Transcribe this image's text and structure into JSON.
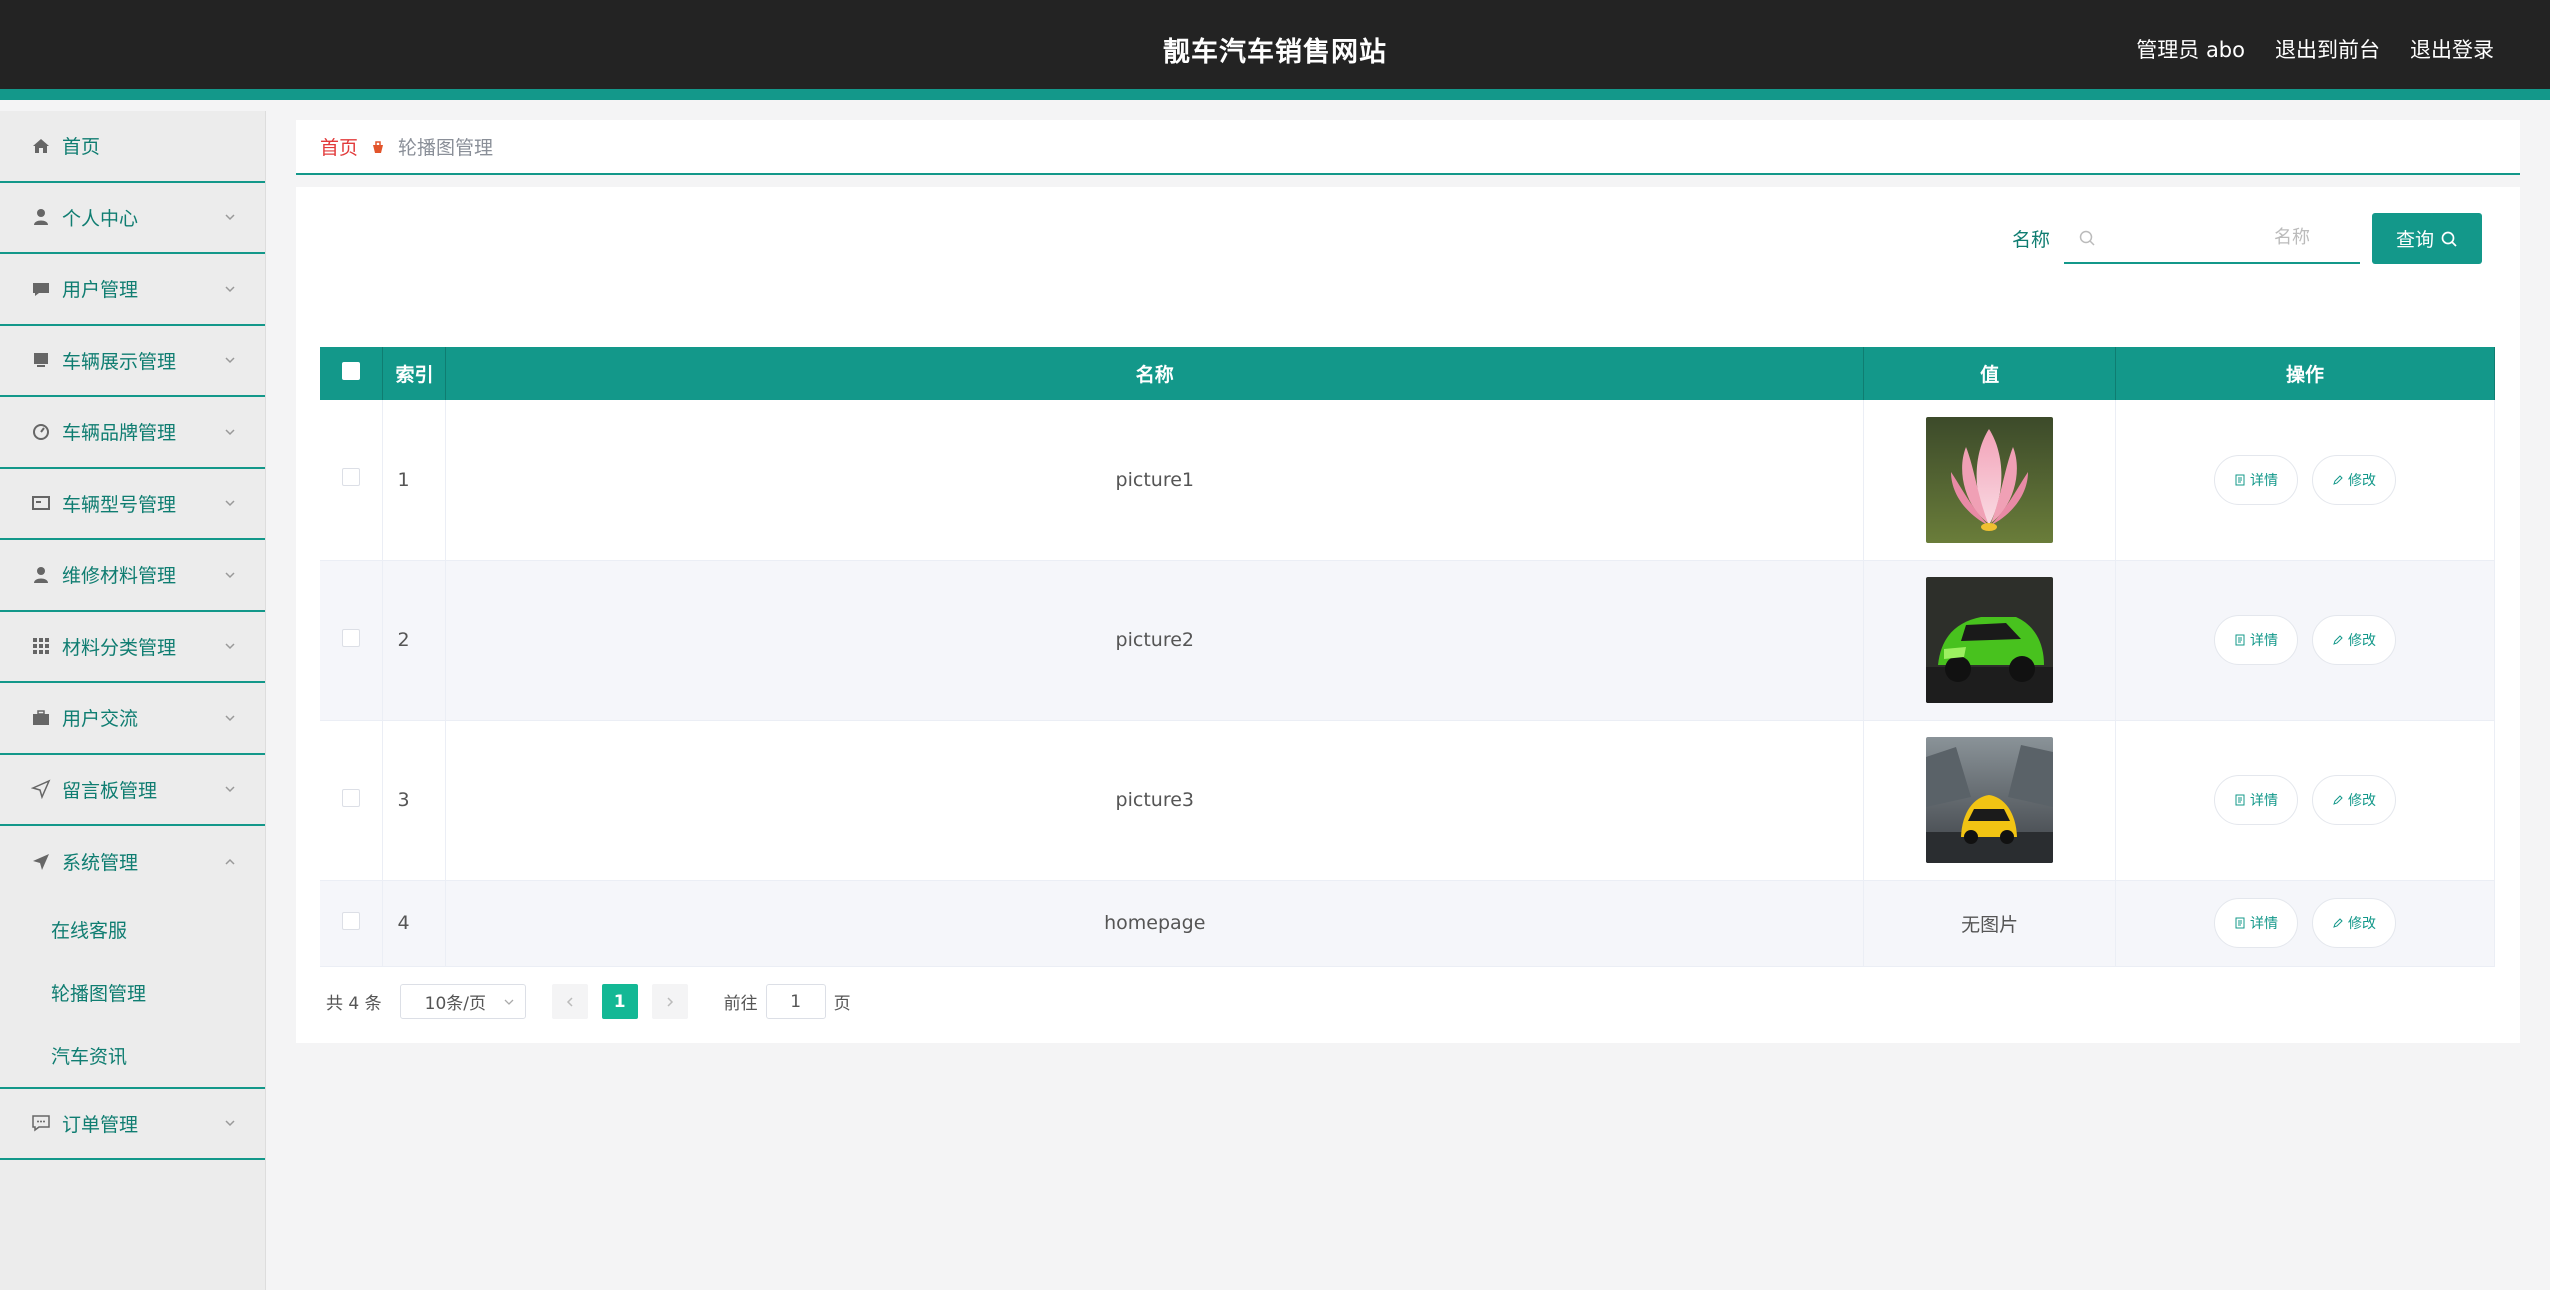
{
  "header": {
    "title": "靓车汽车销售网站",
    "user": "管理员 abo",
    "to_front": "退出到前台",
    "logout": "退出登录"
  },
  "sidebar": {
    "items": [
      {
        "label": "首页",
        "icon": "home-icon"
      },
      {
        "label": "个人中心",
        "icon": "user-icon"
      },
      {
        "label": "用户管理",
        "icon": "chat-icon"
      },
      {
        "label": "车辆展示管理",
        "icon": "monitor-icon"
      },
      {
        "label": "车辆品牌管理",
        "icon": "compass-icon"
      },
      {
        "label": "车辆型号管理",
        "icon": "card-icon"
      },
      {
        "label": "维修材料管理",
        "icon": "user-icon"
      },
      {
        "label": "材料分类管理",
        "icon": "grid-icon"
      },
      {
        "label": "用户交流",
        "icon": "briefcase-icon"
      },
      {
        "label": "留言板管理",
        "icon": "send-icon"
      },
      {
        "label": "系统管理",
        "icon": "paper-plane-icon"
      }
    ],
    "system_sub": [
      "在线客服",
      "轮播图管理",
      "汽车资讯"
    ],
    "order": {
      "label": "订单管理",
      "icon": "message-icon"
    }
  },
  "breadcrumb": {
    "home": "首页",
    "current": "轮播图管理"
  },
  "search": {
    "label": "名称",
    "placeholder": "名称",
    "button": "查询"
  },
  "table": {
    "headers": {
      "index": "索引",
      "name": "名称",
      "value": "值",
      "ops": "操作"
    },
    "rows": [
      {
        "index": "1",
        "name": "picture1",
        "image": "lotus"
      },
      {
        "index": "2",
        "name": "picture2",
        "image": "green-car"
      },
      {
        "index": "3",
        "name": "picture3",
        "image": "yellow-car"
      },
      {
        "index": "4",
        "name": "homepage",
        "value_text": "无图片"
      }
    ],
    "detail_label": "详情",
    "edit_label": "修改"
  },
  "pagination": {
    "total": "共 4 条",
    "page_size": "10条/页",
    "current": "1",
    "goto_label": "前往",
    "goto_value": "1",
    "page_suffix": "页"
  },
  "colors": {
    "accent": "#13988a",
    "header_bg": "#232323",
    "active_page": "#13b895"
  }
}
